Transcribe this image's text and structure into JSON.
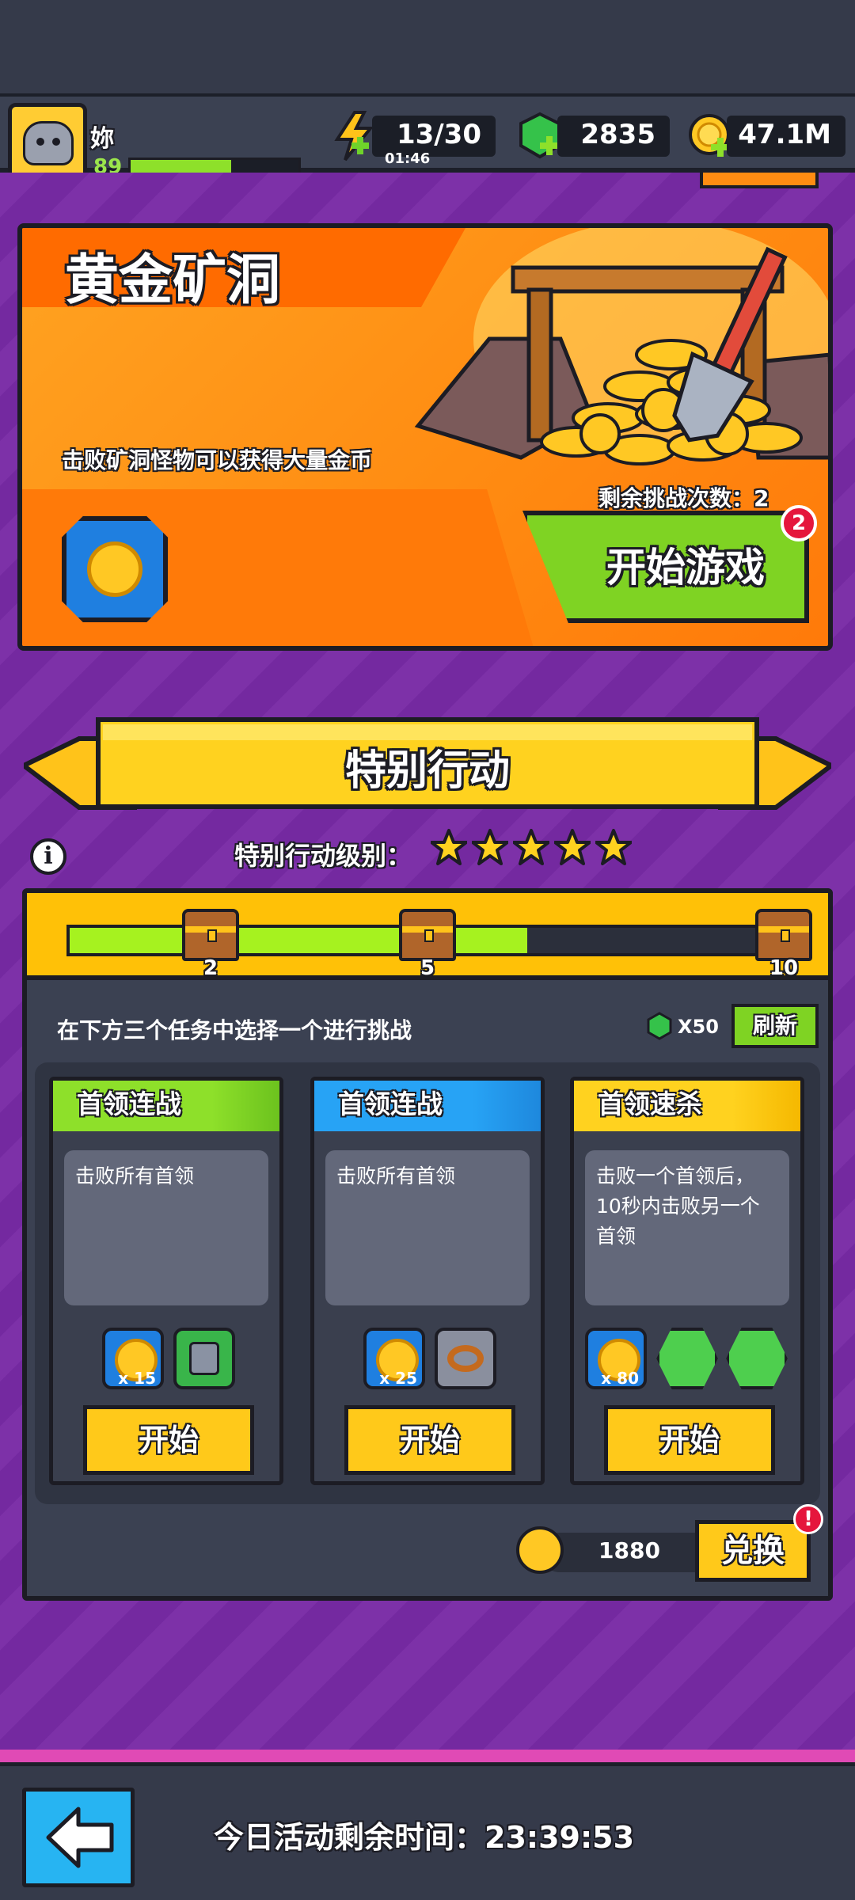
{
  "player": {
    "name": "妳",
    "level": "89",
    "xp_fraction": 0.6
  },
  "resources": {
    "energy": "13/30",
    "energy_timer": "01:46",
    "gems": "2835",
    "gold": "47.1M"
  },
  "banner": {
    "title": "黄金矿洞",
    "description": "击败矿洞怪物可以获得大量金币",
    "remaining_label": "剩余挑战次数：2",
    "play_button": "开始游戏",
    "play_badge": "2"
  },
  "special": {
    "title": "特别行动",
    "level_label": "特别行动级别：",
    "stars": 5
  },
  "progress": {
    "fraction": 0.62,
    "milestones": [
      "2",
      "5",
      "10"
    ]
  },
  "tasks": {
    "instruction": "在下方三个任务中选择一个进行挑战",
    "refresh_cost": "X50",
    "refresh_label": "刷新",
    "cards": [
      {
        "title": "首领连战",
        "description": "击败所有首领",
        "reward_count": "x 15",
        "start": "开始"
      },
      {
        "title": "首领连战",
        "description": "击败所有首领",
        "reward_count": "x 25",
        "start": "开始"
      },
      {
        "title": "首领速杀",
        "description": "击败一个首领后，10秒内击败另一个首领",
        "reward_count": "x 80",
        "start": "开始"
      }
    ]
  },
  "exchange": {
    "tokens": "1880",
    "button": "兑换",
    "badge": "!"
  },
  "footer": {
    "time_label": "今日活动剩余时间：23:39:53"
  },
  "colors": {
    "accent_green": "#7fd323",
    "accent_yellow": "#ffc91a",
    "background_purple": "#7b2fa6",
    "header_blue": "#1e90ff"
  }
}
